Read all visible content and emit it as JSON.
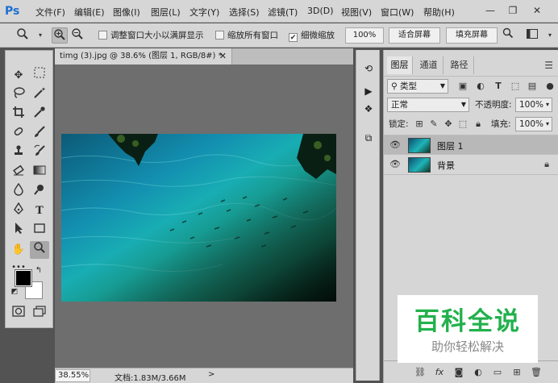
{
  "app": {
    "logo": "Ps"
  },
  "menu": [
    "文件(F)",
    "编辑(E)",
    "图像(I)",
    "图层(L)",
    "文字(Y)",
    "选择(S)",
    "滤镜(T)",
    "3D(D)",
    "视图(V)",
    "窗口(W)",
    "帮助(H)"
  ],
  "window_controls": [
    "minimize-icon",
    "restore-icon",
    "close-icon"
  ],
  "options_bar": {
    "tool_icon": "zoom-icon",
    "zoom_in_icon": "zoom-in-icon",
    "zoom_out_icon": "zoom-out-icon",
    "resize_windows_label": "调整窗口大小以满屏显示",
    "resize_windows_checked": false,
    "zoom_all_label": "缩放所有窗口",
    "zoom_all_checked": false,
    "scrubby_zoom_label": "细微缩放",
    "scrubby_zoom_checked": true,
    "zoom_value": "100%",
    "fit_screen_label": "适合屏幕",
    "fill_screen_label": "填充屏幕"
  },
  "document": {
    "tab_title": "timg (3).jpg @ 38.6% (图层 1, RGB/8#) *",
    "zoom_status": "38.55%",
    "doc_info": "文档:1.83M/3.66M",
    "status_arrow": ">"
  },
  "layers_panel": {
    "tabs": [
      "图层",
      "通道",
      "路径"
    ],
    "filter_kind": "类型",
    "blend_mode": "正常",
    "opacity_label": "不透明度:",
    "opacity_value": "100%",
    "lock_label": "锁定:",
    "fill_label": "填充:",
    "fill_value": "100%",
    "layers": [
      {
        "name": "图层 1",
        "visible": true,
        "selected": true,
        "locked": false
      },
      {
        "name": "背景",
        "visible": true,
        "selected": false,
        "locked": true
      }
    ]
  },
  "watermark": {
    "title": "百科全说",
    "subtitle": "助你轻松解决"
  }
}
